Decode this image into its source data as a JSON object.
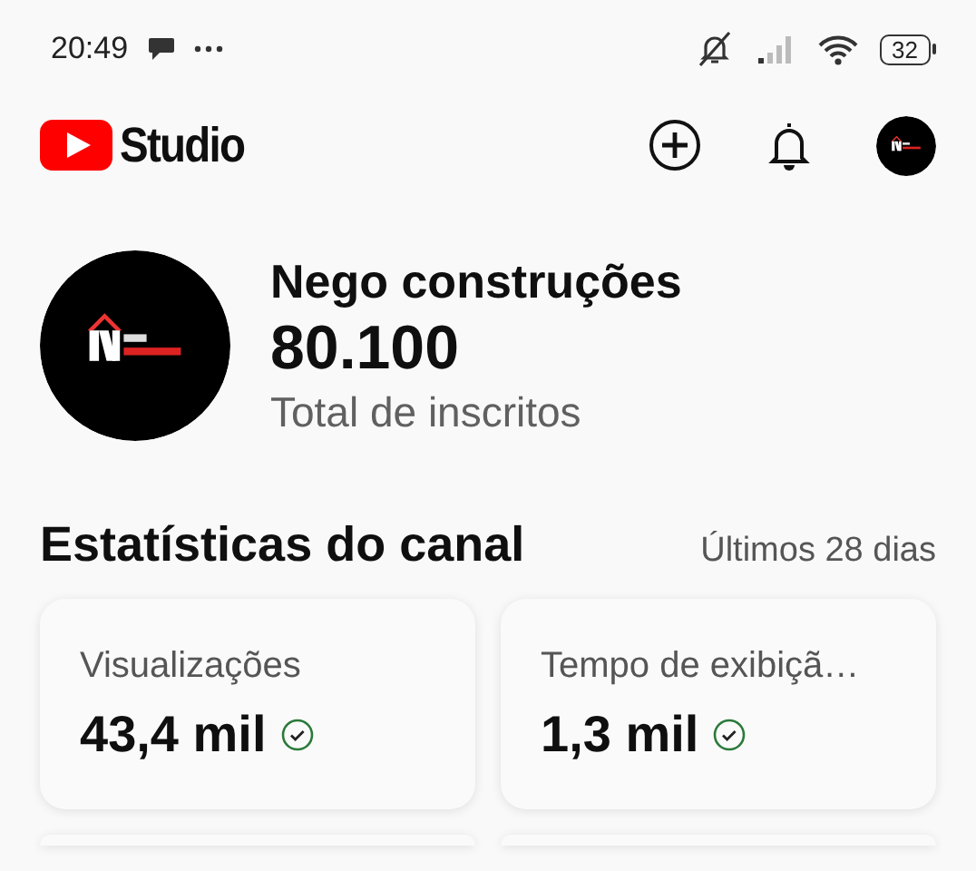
{
  "status_bar": {
    "time": "20:49",
    "battery": "32"
  },
  "header": {
    "logo_text": "Studio"
  },
  "channel": {
    "name": "Nego construções",
    "subscribers": "80.100",
    "subscribers_label": "Total de inscritos"
  },
  "stats": {
    "title": "Estatísticas do canal",
    "period": "Últimos 28 dias",
    "cards": [
      {
        "label": "Visualizações",
        "value": "43,4 mil"
      },
      {
        "label": "Tempo de exibiçã…",
        "value": "1,3 mil"
      }
    ]
  }
}
